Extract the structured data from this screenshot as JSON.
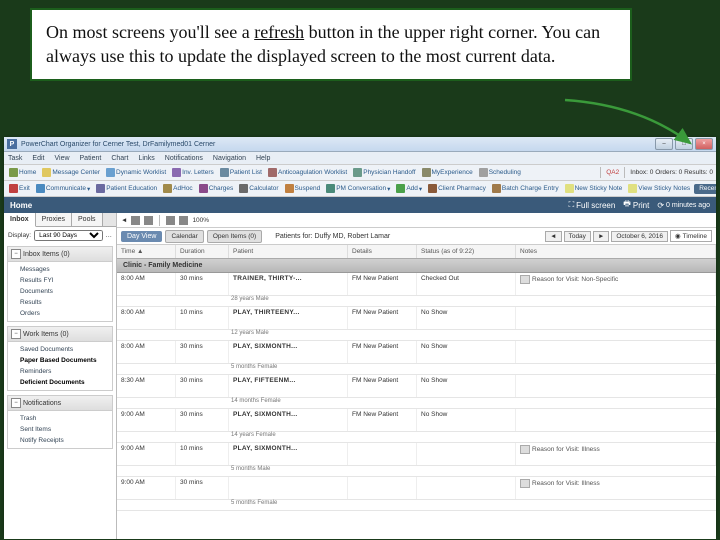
{
  "callout": {
    "t1": "On most screens you'll see a ",
    "u": "refresh",
    "t2": " button in the upper right corner.  You can always use this to update the displayed screen to the most current data."
  },
  "titlebar": {
    "icon": "P",
    "title": "PowerChart Organizer for Cerner Test, DrFamilymed01 Cerner"
  },
  "menus": [
    "Task",
    "Edit",
    "View",
    "Patient",
    "Chart",
    "Links",
    "Notifications",
    "Navigation",
    "Help"
  ],
  "tbar1": {
    "items": [
      "Home",
      "Message Center",
      "Dynamic Worklist",
      "Inv. Letters",
      "Patient List",
      "Anticoagulation Worklist",
      "Physician Handoff",
      "MyExperience",
      "Scheduling"
    ],
    "right": {
      "qa": "QA2",
      "orders": "Inbox: 0  Orders: 0  Results: 0"
    }
  },
  "tbar2": {
    "items": [
      "Exit",
      "Communicate",
      "Patient Education",
      "AdHoc",
      "Charges",
      "Calculator",
      "Suspend",
      "PM Conversation",
      "Add",
      "Client Pharmacy",
      "Batch Charge Entry",
      "New Sticky Note",
      "View Sticky Notes"
    ]
  },
  "tbar3": {
    "recent": "Recent"
  },
  "homebar": {
    "title": "Home",
    "fullscreen": "Full screen",
    "print": "Print",
    "refresh": "0 minutes ago"
  },
  "sidebar": {
    "tabs": [
      "Inbox",
      "Proxies",
      "Pools"
    ],
    "display_label": "Display:",
    "display_value": "Last 90 Days",
    "sect1": {
      "title": "Inbox Items (0)",
      "items": [
        "Messages",
        "Results FYI",
        "Documents",
        "Results",
        "Orders"
      ]
    },
    "sect2": {
      "title": "Work Items (0)",
      "items": [
        "Saved Documents",
        "Paper Based Documents",
        "Reminders",
        "Deficient Documents"
      ],
      "bold": [
        1,
        3
      ]
    },
    "sect3": {
      "title": "Notifications",
      "items": [
        "Trash",
        "Sent Items",
        "Notify Receipts"
      ]
    }
  },
  "main": {
    "zoom": "100%",
    "views": {
      "day": "Day View",
      "cal": "Calendar",
      "open": "Open Items (0)"
    },
    "patients_for": "Patients for: Duffy MD, Robert Lamar",
    "today": "Today",
    "date": "October 6, 2016",
    "timeline": "Timeline",
    "cols": {
      "time": "Time",
      "dur": "Duration",
      "pat": "Patient",
      "det": "Details",
      "stat": "Status (as of 9:22)",
      "notes": "Notes"
    },
    "group": "Clinic - Family Medicine",
    "rows": [
      {
        "time": "8:00 AM",
        "dur": "30 mins",
        "pat": "TRAINER, THIRTY-...",
        "stat1": "FM New Patient",
        "stat2": "Checked Out",
        "sub": "28 years  Male",
        "reason": "Reason for Visit: Non-Specific"
      },
      {
        "time": "8:00 AM",
        "dur": "10 mins",
        "pat": "PLAY, THIRTEENY...",
        "stat1": "FM New Patient",
        "stat2": "No Show",
        "sub": "12 years  Male",
        "reason": ""
      },
      {
        "time": "8:00 AM",
        "dur": "30 mins",
        "pat": "PLAY, SIXMONTH...",
        "stat1": "FM New Patient",
        "stat2": "No Show",
        "sub": "5 months  Female",
        "reason": ""
      },
      {
        "time": "8:30 AM",
        "dur": "30 mins",
        "pat": "PLAY, FIFTEENM...",
        "stat1": "FM New Patient",
        "stat2": "No Show",
        "sub": "14 months  Female",
        "reason": ""
      },
      {
        "time": "9:00 AM",
        "dur": "30 mins",
        "pat": "PLAY, SIXMONTH...",
        "stat1": "FM New Patient",
        "stat2": "No Show",
        "sub": "14 years  Female",
        "reason": ""
      },
      {
        "time": "9:00 AM",
        "dur": "10 mins",
        "pat": "PLAY, SIXMONTH...",
        "stat1": "",
        "stat2": "",
        "sub": "5 months  Male",
        "reason": "Reason for Visit: Illness"
      },
      {
        "time": "9:00 AM",
        "dur": "30 mins",
        "pat": "",
        "stat1": "",
        "stat2": "",
        "sub": "5 months  Female",
        "reason": "Reason for Visit: Illness"
      }
    ]
  }
}
